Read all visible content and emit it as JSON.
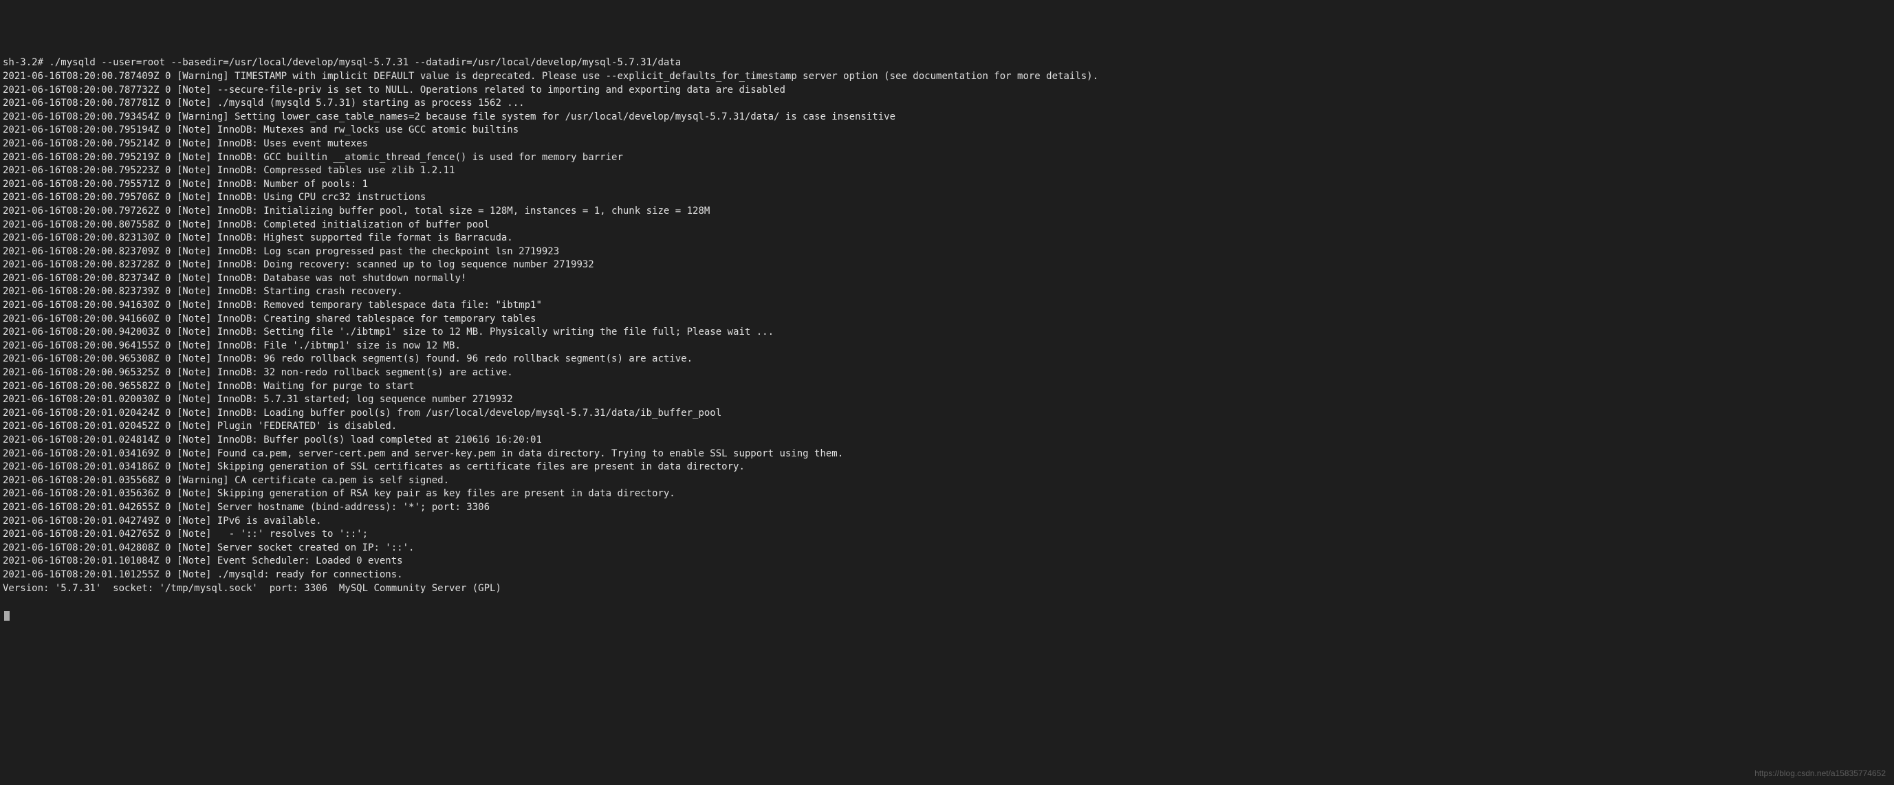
{
  "terminal": {
    "lines": [
      "sh-3.2# ./mysqld --user=root --basedir=/usr/local/develop/mysql-5.7.31 --datadir=/usr/local/develop/mysql-5.7.31/data",
      "2021-06-16T08:20:00.787409Z 0 [Warning] TIMESTAMP with implicit DEFAULT value is deprecated. Please use --explicit_defaults_for_timestamp server option (see documentation for more details).",
      "2021-06-16T08:20:00.787732Z 0 [Note] --secure-file-priv is set to NULL. Operations related to importing and exporting data are disabled",
      "2021-06-16T08:20:00.787781Z 0 [Note] ./mysqld (mysqld 5.7.31) starting as process 1562 ...",
      "2021-06-16T08:20:00.793454Z 0 [Warning] Setting lower_case_table_names=2 because file system for /usr/local/develop/mysql-5.7.31/data/ is case insensitive",
      "2021-06-16T08:20:00.795194Z 0 [Note] InnoDB: Mutexes and rw_locks use GCC atomic builtins",
      "2021-06-16T08:20:00.795214Z 0 [Note] InnoDB: Uses event mutexes",
      "2021-06-16T08:20:00.795219Z 0 [Note] InnoDB: GCC builtin __atomic_thread_fence() is used for memory barrier",
      "2021-06-16T08:20:00.795223Z 0 [Note] InnoDB: Compressed tables use zlib 1.2.11",
      "2021-06-16T08:20:00.795571Z 0 [Note] InnoDB: Number of pools: 1",
      "2021-06-16T08:20:00.795706Z 0 [Note] InnoDB: Using CPU crc32 instructions",
      "2021-06-16T08:20:00.797262Z 0 [Note] InnoDB: Initializing buffer pool, total size = 128M, instances = 1, chunk size = 128M",
      "2021-06-16T08:20:00.807558Z 0 [Note] InnoDB: Completed initialization of buffer pool",
      "2021-06-16T08:20:00.823130Z 0 [Note] InnoDB: Highest supported file format is Barracuda.",
      "2021-06-16T08:20:00.823709Z 0 [Note] InnoDB: Log scan progressed past the checkpoint lsn 2719923",
      "2021-06-16T08:20:00.823728Z 0 [Note] InnoDB: Doing recovery: scanned up to log sequence number 2719932",
      "2021-06-16T08:20:00.823734Z 0 [Note] InnoDB: Database was not shutdown normally!",
      "2021-06-16T08:20:00.823739Z 0 [Note] InnoDB: Starting crash recovery.",
      "2021-06-16T08:20:00.941630Z 0 [Note] InnoDB: Removed temporary tablespace data file: \"ibtmp1\"",
      "2021-06-16T08:20:00.941660Z 0 [Note] InnoDB: Creating shared tablespace for temporary tables",
      "2021-06-16T08:20:00.942003Z 0 [Note] InnoDB: Setting file './ibtmp1' size to 12 MB. Physically writing the file full; Please wait ...",
      "2021-06-16T08:20:00.964155Z 0 [Note] InnoDB: File './ibtmp1' size is now 12 MB.",
      "2021-06-16T08:20:00.965308Z 0 [Note] InnoDB: 96 redo rollback segment(s) found. 96 redo rollback segment(s) are active.",
      "2021-06-16T08:20:00.965325Z 0 [Note] InnoDB: 32 non-redo rollback segment(s) are active.",
      "2021-06-16T08:20:00.965582Z 0 [Note] InnoDB: Waiting for purge to start",
      "2021-06-16T08:20:01.020030Z 0 [Note] InnoDB: 5.7.31 started; log sequence number 2719932",
      "2021-06-16T08:20:01.020424Z 0 [Note] InnoDB: Loading buffer pool(s) from /usr/local/develop/mysql-5.7.31/data/ib_buffer_pool",
      "2021-06-16T08:20:01.020452Z 0 [Note] Plugin 'FEDERATED' is disabled.",
      "2021-06-16T08:20:01.024814Z 0 [Note] InnoDB: Buffer pool(s) load completed at 210616 16:20:01",
      "2021-06-16T08:20:01.034169Z 0 [Note] Found ca.pem, server-cert.pem and server-key.pem in data directory. Trying to enable SSL support using them.",
      "2021-06-16T08:20:01.034186Z 0 [Note] Skipping generation of SSL certificates as certificate files are present in data directory.",
      "2021-06-16T08:20:01.035568Z 0 [Warning] CA certificate ca.pem is self signed.",
      "2021-06-16T08:20:01.035636Z 0 [Note] Skipping generation of RSA key pair as key files are present in data directory.",
      "2021-06-16T08:20:01.042655Z 0 [Note] Server hostname (bind-address): '*'; port: 3306",
      "2021-06-16T08:20:01.042749Z 0 [Note] IPv6 is available.",
      "2021-06-16T08:20:01.042765Z 0 [Note]   - '::' resolves to '::';",
      "2021-06-16T08:20:01.042808Z 0 [Note] Server socket created on IP: '::'.",
      "2021-06-16T08:20:01.101084Z 0 [Note] Event Scheduler: Loaded 0 events",
      "2021-06-16T08:20:01.101255Z 0 [Note] ./mysqld: ready for connections.",
      "Version: '5.7.31'  socket: '/tmp/mysql.sock'  port: 3306  MySQL Community Server (GPL)"
    ]
  },
  "watermark": "https://blog.csdn.net/a15835774652"
}
